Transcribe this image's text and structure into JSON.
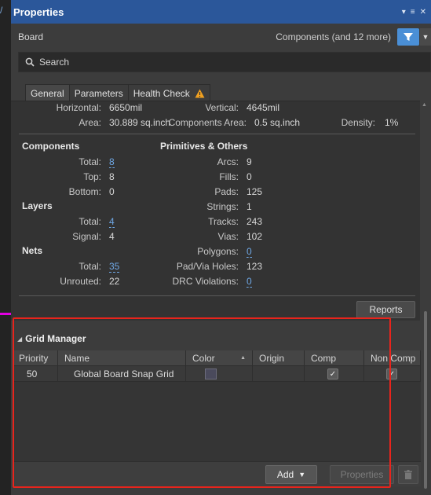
{
  "window": {
    "title": "Properties",
    "controls": [
      "▾",
      "≡",
      "✕"
    ]
  },
  "board": {
    "label": "Board",
    "filter_text": "Components (and 12 more)"
  },
  "search": {
    "placeholder": "Search"
  },
  "tabs": [
    {
      "label": "General",
      "active": true
    },
    {
      "label": "Parameters",
      "active": false
    },
    {
      "label": "Health Check",
      "active": false,
      "icon": "warning-icon"
    }
  ],
  "dimensions": {
    "horizontal_label": "Horizontal:",
    "horizontal_value": "6650mil",
    "vertical_label": "Vertical:",
    "vertical_value": "4645mil",
    "area_label": "Area:",
    "area_value": "30.889 sq.inch",
    "comp_area_label": "Components Area:",
    "comp_area_value": "0.5 sq.inch",
    "density_label": "Density:",
    "density_value": "1%"
  },
  "components": {
    "header": "Components",
    "total_label": "Total:",
    "total_value": "8",
    "top_label": "Top:",
    "top_value": "8",
    "bottom_label": "Bottom:",
    "bottom_value": "0"
  },
  "layers": {
    "header": "Layers",
    "total_label": "Total:",
    "total_value": "4",
    "signal_label": "Signal:",
    "signal_value": "4"
  },
  "nets": {
    "header": "Nets",
    "total_label": "Total:",
    "total_value": "35",
    "unrouted_label": "Unrouted:",
    "unrouted_value": "22"
  },
  "primitives": {
    "header": "Primitives & Others",
    "items": [
      {
        "label": "Arcs:",
        "value": "9",
        "link": false
      },
      {
        "label": "Fills:",
        "value": "0",
        "link": false
      },
      {
        "label": "Pads:",
        "value": "125",
        "link": false
      },
      {
        "label": "Strings:",
        "value": "1",
        "link": false
      },
      {
        "label": "Tracks:",
        "value": "243",
        "link": false
      },
      {
        "label": "Vias:",
        "value": "102",
        "link": false
      },
      {
        "label": "Polygons:",
        "value": "0",
        "link": true
      },
      {
        "label": "Pad/Via Holes:",
        "value": "123",
        "link": false
      },
      {
        "label": "DRC Violations:",
        "value": "0",
        "link": true
      }
    ]
  },
  "reports_button": "Reports",
  "grid_manager": {
    "title": "Grid Manager",
    "columns": [
      "Priority",
      "Name",
      "Color",
      "Origin",
      "Comp",
      "Non Comp"
    ],
    "rows": [
      {
        "priority": "50",
        "name": "Global Board Snap Grid",
        "comp_checked": true,
        "noncomp_checked": true
      }
    ],
    "add_button": "Add",
    "properties_button": "Properties"
  },
  "colors": {
    "title_bar": "#2b579a",
    "accent": "#4a8fd6",
    "link": "#6fa8e6",
    "highlight": "#e8241c"
  }
}
